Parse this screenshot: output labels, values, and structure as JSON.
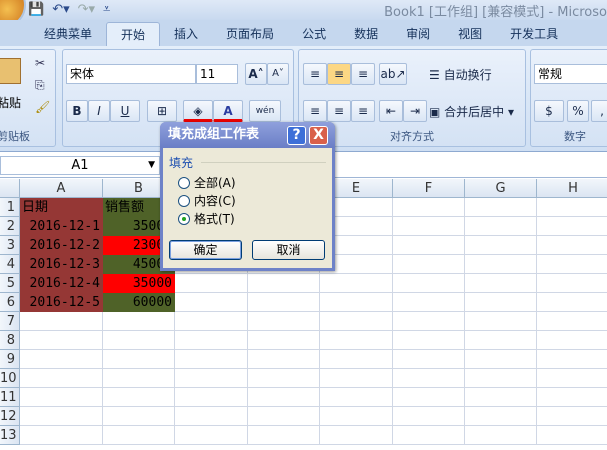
{
  "window": {
    "title": "Book1 [工作组] [兼容模式] - Microso"
  },
  "qat": {
    "save": "💾",
    "undo": "↶▾",
    "redo": "↷▾",
    "customize": "⩡"
  },
  "tabs": [
    "经典菜单",
    "开始",
    "插入",
    "页面布局",
    "公式",
    "数据",
    "审阅",
    "视图",
    "开发工具"
  ],
  "ribbon": {
    "clipboard": {
      "label": "剪贴板",
      "paste": "粘贴"
    },
    "font": {
      "name": "宋体",
      "size": "11",
      "grow": "A˄",
      "shrink": "A˅",
      "bold": "B",
      "italic": "I",
      "underline": "U",
      "phonetic": "wén"
    },
    "alignment": {
      "label": "对齐方式",
      "wrap": "自动换行",
      "merge": "合并后居中"
    },
    "number": {
      "label": "数字",
      "format": "常规",
      "percent": "%",
      "comma": ","
    }
  },
  "namebox": "A1",
  "columns": [
    "A",
    "B",
    "C",
    "D",
    "E",
    "F",
    "G",
    "H"
  ],
  "rows": [
    "1",
    "2",
    "3",
    "4",
    "5",
    "6",
    "7",
    "8",
    "9",
    "10",
    "11",
    "12",
    "13"
  ],
  "cells": [
    {
      "a": "日期",
      "b": "销售额"
    },
    {
      "a": "2016-12-1",
      "b": "35000"
    },
    {
      "a": "2016-12-2",
      "b": "23000"
    },
    {
      "a": "2016-12-3",
      "b": "45000"
    },
    {
      "a": "2016-12-4",
      "b": "35000"
    },
    {
      "a": "2016-12-5",
      "b": "60000"
    }
  ],
  "colors": {
    "dateFill": "#953735",
    "green": "#4f6228",
    "red": "#ff0000"
  },
  "dialog": {
    "title": "填充成组工作表",
    "help": "?",
    "close": "X",
    "group": "填充",
    "options": [
      "全部(A)",
      "内容(C)",
      "格式(T)"
    ],
    "selected": 2,
    "ok": "确定",
    "cancel": "取消"
  }
}
